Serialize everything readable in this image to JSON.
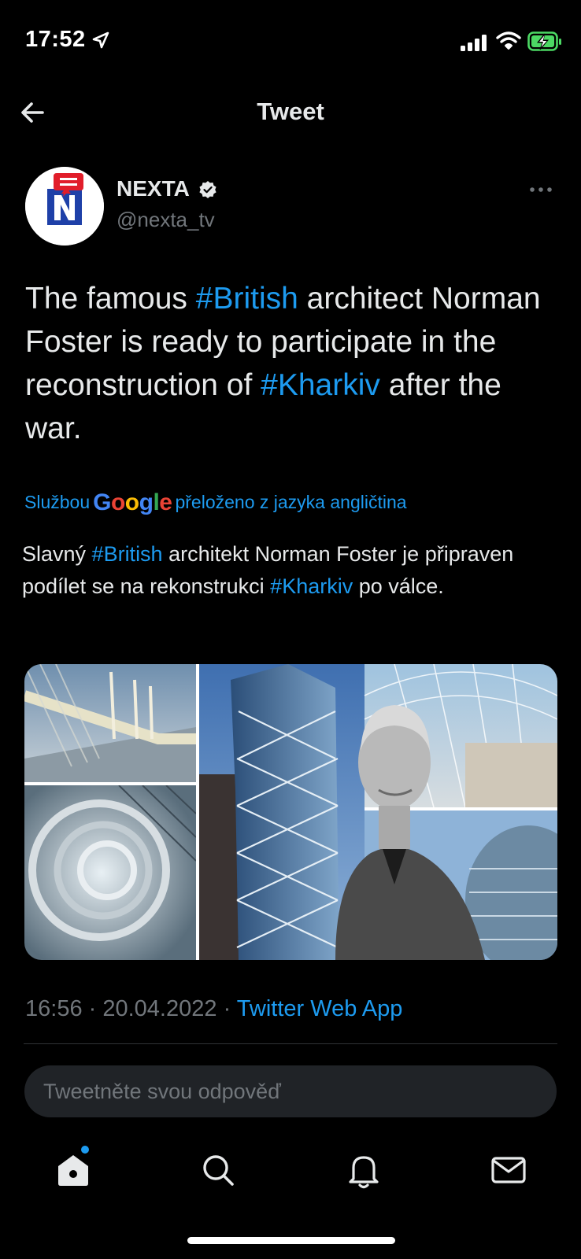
{
  "status_bar": {
    "time": "17:52"
  },
  "header": {
    "title": "Tweet"
  },
  "author": {
    "name": "NEXTA",
    "handle": "@nexta_tv"
  },
  "tweet": {
    "text_part1": "The famous ",
    "hashtag1": "#British",
    "text_part2": " architect Norman Foster is ready to participate in the reconstruction of ",
    "hashtag2": "#Kharkiv",
    "text_part3": " after the war."
  },
  "translation": {
    "prefix": "Službou",
    "google_logo": "Google",
    "suffix": "přeloženo z jazyka angličtina",
    "text_part1": "Slavný ",
    "hashtag1": "#British",
    "text_part2": " architekt Norman Foster je připraven podílet se na rekonstrukci ",
    "hashtag2": "#Kharkiv",
    "text_part3": " po válce."
  },
  "meta": {
    "time": "16:56",
    "separator": " · ",
    "date": "20.04.2022",
    "app": "Twitter Web App"
  },
  "reply": {
    "placeholder": "Tweetněte svou odpověď"
  },
  "tabbar": {
    "icons": [
      "home-icon",
      "search-icon",
      "notifications-icon",
      "messages-icon"
    ]
  },
  "colors": {
    "background": "#000000",
    "accent": "#1d9bf0",
    "text": "#e7e9ea",
    "muted": "#71767b"
  }
}
